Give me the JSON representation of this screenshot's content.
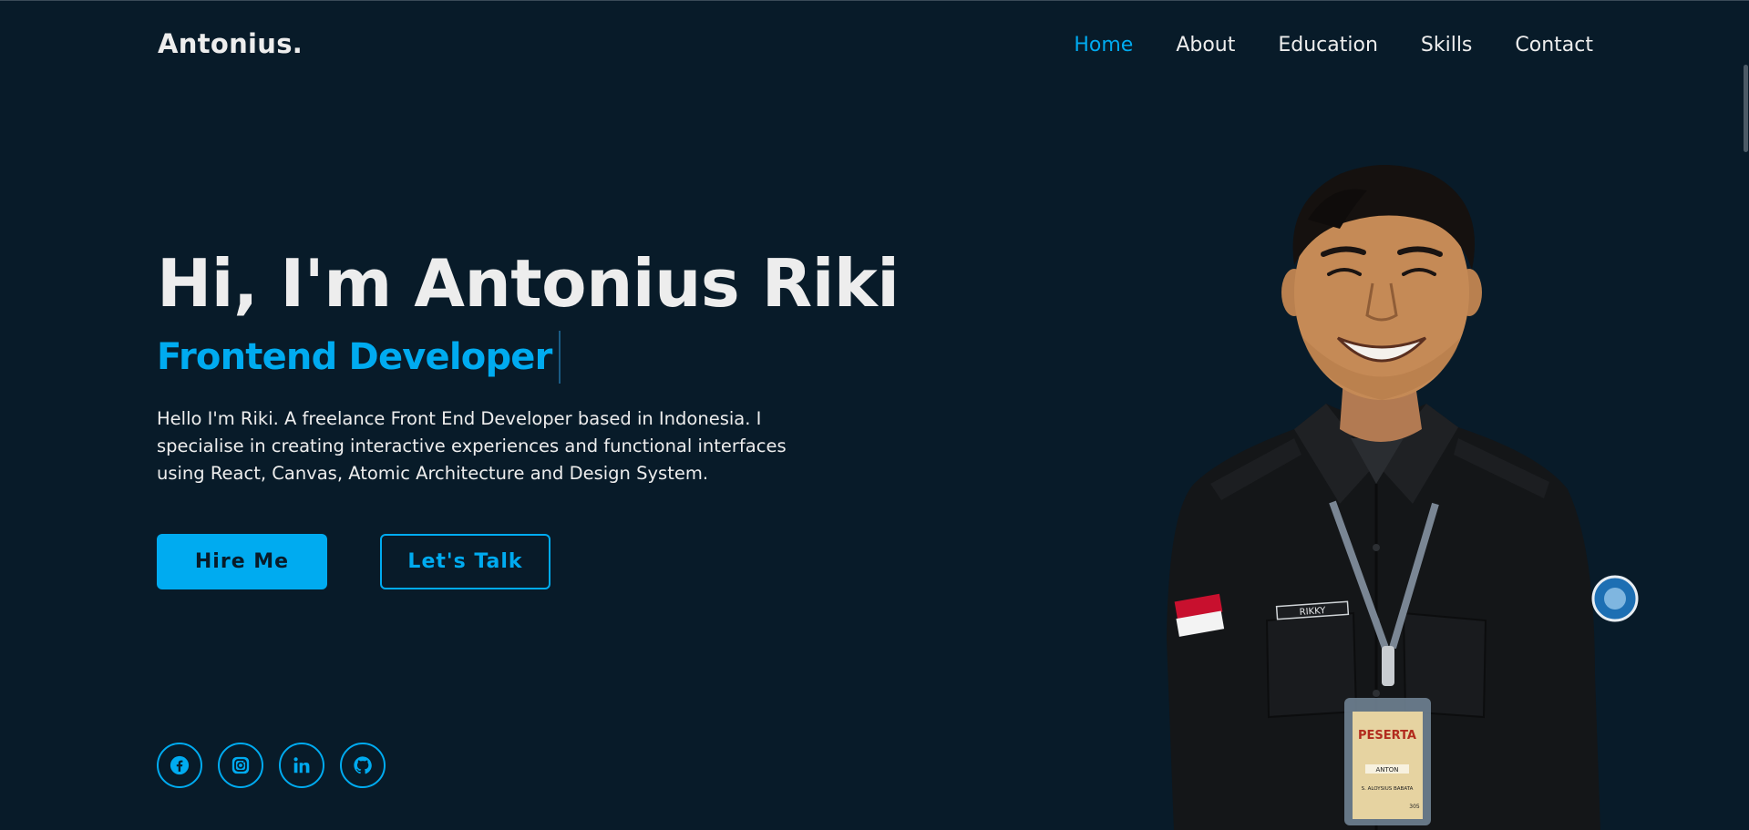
{
  "header": {
    "logo": "Antonius.",
    "nav": [
      {
        "label": "Home",
        "active": true
      },
      {
        "label": "About",
        "active": false
      },
      {
        "label": "Education",
        "active": false
      },
      {
        "label": "Skills",
        "active": false
      },
      {
        "label": "Contact",
        "active": false
      }
    ]
  },
  "hero": {
    "title": "Hi, I'm Antonius Riki",
    "role": "Frontend Developer",
    "description": "Hello I'm Riki. A freelance Front End Developer based in Indonesia. I specialise in creating interactive experiences and functional interfaces using React, Canvas, Atomic Architecture and Design System.",
    "hire_label": "Hire Me",
    "talk_label": "Let's Talk"
  },
  "portrait": {
    "name_tag": "RIKKY",
    "badge_title": "PESERTA",
    "badge_name": "ANTON",
    "badge_school": "S. ALOYSIUS BABATA",
    "badge_number": "305"
  },
  "socials": [
    {
      "icon": "facebook-icon"
    },
    {
      "icon": "instagram-icon"
    },
    {
      "icon": "linkedin-icon"
    },
    {
      "icon": "github-icon"
    }
  ],
  "colors": {
    "background": "#081b29",
    "accent": "#00abf0",
    "text": "#ededed"
  }
}
